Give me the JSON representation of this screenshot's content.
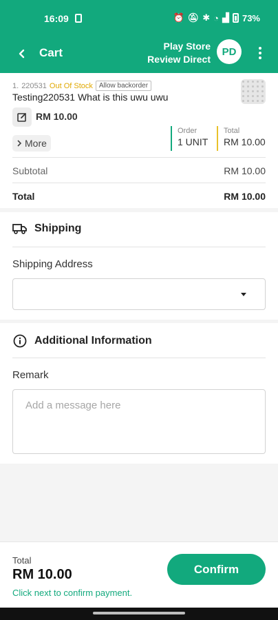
{
  "status_bar": {
    "time": "16:09",
    "battery": "73%"
  },
  "app_bar": {
    "title": "Cart",
    "store_line1": "Play Store",
    "store_line2": "Review Direct",
    "avatar_initials": "PD"
  },
  "cart_item": {
    "index": "1.",
    "code": "220531",
    "stock_status": "Out Of Stock",
    "backorder_badge": "Allow backorder",
    "name": "Testing220531 What is this uwu uwu",
    "unit_price": "RM 10.00",
    "more_label": "More",
    "order_label": "Order",
    "order_value": "1 UNIT",
    "total_label": "Total",
    "total_value": "RM 10.00"
  },
  "summary": {
    "subtotal_label": "Subtotal",
    "subtotal_value": "RM 10.00",
    "total_label": "Total",
    "total_value": "RM 10.00"
  },
  "shipping": {
    "heading": "Shipping",
    "address_label": "Shipping Address",
    "address_value": ""
  },
  "additional": {
    "heading": "Additional Information",
    "remark_label": "Remark",
    "remark_placeholder": "Add a message here"
  },
  "footer": {
    "total_label": "Total",
    "total_value": "RM 10.00",
    "hint": "Click next to confirm payment.",
    "confirm_label": "Confirm"
  },
  "colors": {
    "primary": "#12a97d",
    "out_of_stock": "#e0a800",
    "total_accent": "#e8c12a"
  },
  "icons": [
    "back-arrow-icon",
    "kebab-menu-icon",
    "edit-icon",
    "chevron-right-icon",
    "truck-icon",
    "info-icon",
    "dropdown-caret-icon"
  ]
}
